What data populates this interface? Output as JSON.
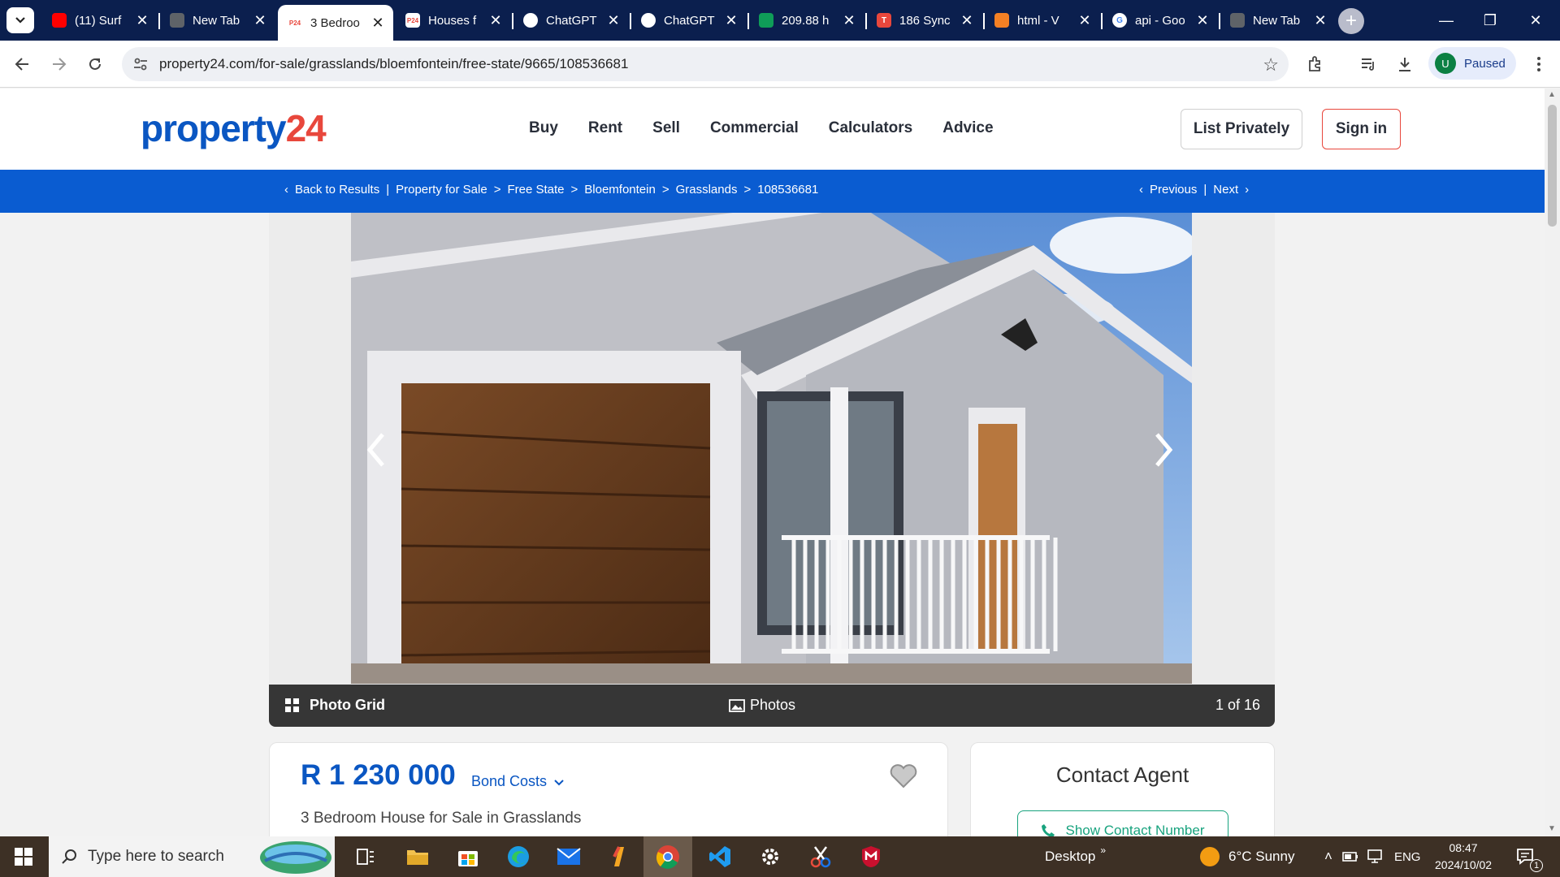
{
  "browser": {
    "tabs": [
      {
        "title": "(11) Surf",
        "favicon": "youtube-icon"
      },
      {
        "title": "New Tab",
        "favicon": "chrome-newtab-icon"
      },
      {
        "title": "3 Bedroo",
        "favicon": "property24-icon",
        "favicon_text": "P24",
        "active": true
      },
      {
        "title": "Houses f",
        "favicon": "property24-icon",
        "favicon_text": "P24"
      },
      {
        "title": "ChatGPT",
        "favicon": "openai-icon"
      },
      {
        "title": "ChatGPT",
        "favicon": "openai-icon"
      },
      {
        "title": "209.88 h",
        "favicon": "sheets-icon"
      },
      {
        "title": "186 Sync",
        "favicon": "t-logo-icon",
        "favicon_text": "T"
      },
      {
        "title": "html - V",
        "favicon": "stackoverflow-icon"
      },
      {
        "title": "api - Goo",
        "favicon": "google-icon",
        "favicon_text": "G"
      },
      {
        "title": "New Tab",
        "favicon": "chrome-newtab-icon"
      }
    ],
    "url": "property24.com/for-sale/grasslands/bloemfontein/free-state/9665/108536681",
    "profile": {
      "initial": "U",
      "label": "Paused"
    }
  },
  "site": {
    "logo": {
      "part1": "property",
      "part2": "24"
    },
    "nav": [
      "Buy",
      "Rent",
      "Sell",
      "Commercial",
      "Calculators",
      "Advice"
    ],
    "list_privately": "List Privately",
    "sign_in": "Sign in"
  },
  "breadcrumb": {
    "back": "Back to Results",
    "items": [
      "Property for Sale",
      "Free State",
      "Bloemfontein",
      "Grasslands",
      "108536681"
    ],
    "previous": "Previous",
    "next": "Next"
  },
  "gallery": {
    "photo_grid": "Photo Grid",
    "photos": "Photos",
    "counter": "1 of 16"
  },
  "listing": {
    "price": "R 1 230 000",
    "bond_costs": "Bond Costs",
    "title": "3 Bedroom House for Sale in Grasslands"
  },
  "contact": {
    "heading": "Contact Agent",
    "show_number": "Show Contact Number"
  },
  "taskbar": {
    "search_placeholder": "Type here to search",
    "desktop_label": "Desktop",
    "weather": "6°C  Sunny",
    "language": "ENG",
    "time": "08:47",
    "date": "2024/10/02",
    "notifications": "1"
  },
  "colors": {
    "brand_blue": "#0a56c2",
    "brand_red": "#e8473c",
    "crumb_bar": "#0a5cd1",
    "contact_green": "#18a37e"
  }
}
